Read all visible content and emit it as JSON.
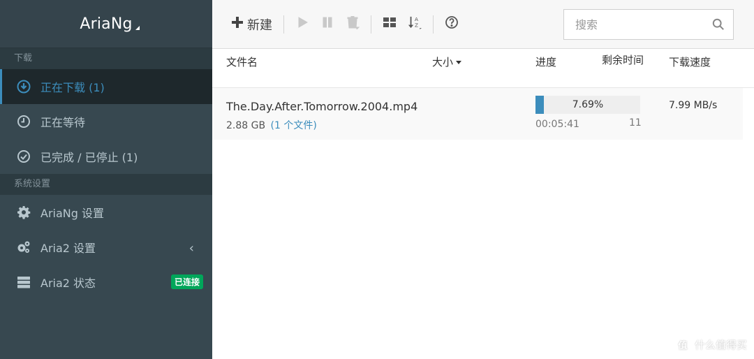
{
  "app": {
    "title": "AriaNg"
  },
  "sidebar": {
    "section_download": "下载",
    "section_settings": "系统设置",
    "items": [
      {
        "label": "正在下载 (1)",
        "icon": "download-circle-icon",
        "active": true
      },
      {
        "label": "正在等待",
        "icon": "clock-icon"
      },
      {
        "label": "已完成 / 已停止 (1)",
        "icon": "check-circle-icon"
      },
      {
        "label": "AriaNg 设置",
        "icon": "gear-icon"
      },
      {
        "label": "Aria2 设置",
        "icon": "gears-icon"
      },
      {
        "label": "Aria2 状态",
        "icon": "server-icon",
        "badge": "已连接"
      }
    ],
    "chevron": "‹"
  },
  "toolbar": {
    "new_label": "新建",
    "search_placeholder": "搜索"
  },
  "table": {
    "headers": {
      "name": "文件名",
      "size": "大小",
      "progress": "进度",
      "remaining": "剩余时间",
      "speed": "下载速度"
    }
  },
  "task": {
    "name": "The.Day.After.Tomorrow.2004.mp4",
    "size": "2.88 GB",
    "files": "(1 个文件)",
    "progress_value": 0.0769,
    "progress_text": "7.69%",
    "eta": "00:05:41",
    "connections": "11",
    "speed": "7.99 MB/s"
  },
  "watermark": {
    "text": "什么值得买",
    "mark": "值"
  },
  "colors": {
    "sidebar_bg": "#374850",
    "accent": "#3c8dbc",
    "badge_green": "#00a65a"
  }
}
